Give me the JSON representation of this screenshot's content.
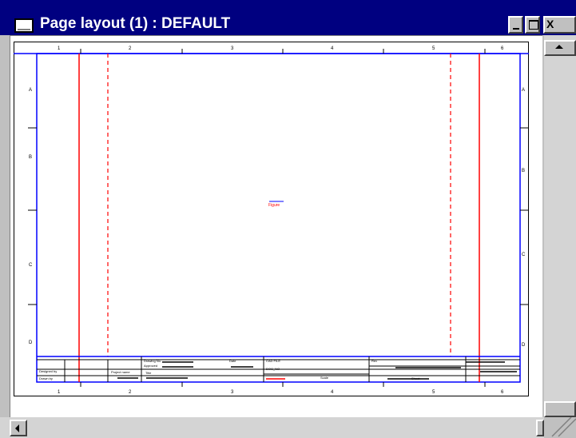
{
  "window": {
    "title": "Page layout (1) : DEFAULT",
    "close_glyph": "X",
    "icon": "page-layout-window-icon"
  },
  "ruler": {
    "top": [
      "1",
      "2",
      "3",
      "4",
      "5",
      "6"
    ],
    "bottom": [
      "1",
      "2",
      "3",
      "4",
      "5",
      "6"
    ],
    "left": [
      "A",
      "B",
      "C",
      "D"
    ],
    "right": [
      "A",
      "B",
      "C",
      "D"
    ]
  },
  "sheet": {
    "figure_label": "Figure",
    "title_block": {
      "designed_by": "Designed by",
      "drawn_by": "Drawn by",
      "project_name": "Project name",
      "drawing_number": "Drawing No.",
      "approved": "Approved",
      "title": "Title",
      "sheet": "Sheet",
      "scale": "Scale",
      "rev": "Rev",
      "date": "Date",
      "cad_file": "CAD FILE",
      "doc_no": "DOC_NO"
    }
  },
  "colors": {
    "titlebar": "#000080",
    "frame_blue": "#0000ff",
    "margin_red": "#ff0000",
    "chrome": "#c0c0c0"
  }
}
